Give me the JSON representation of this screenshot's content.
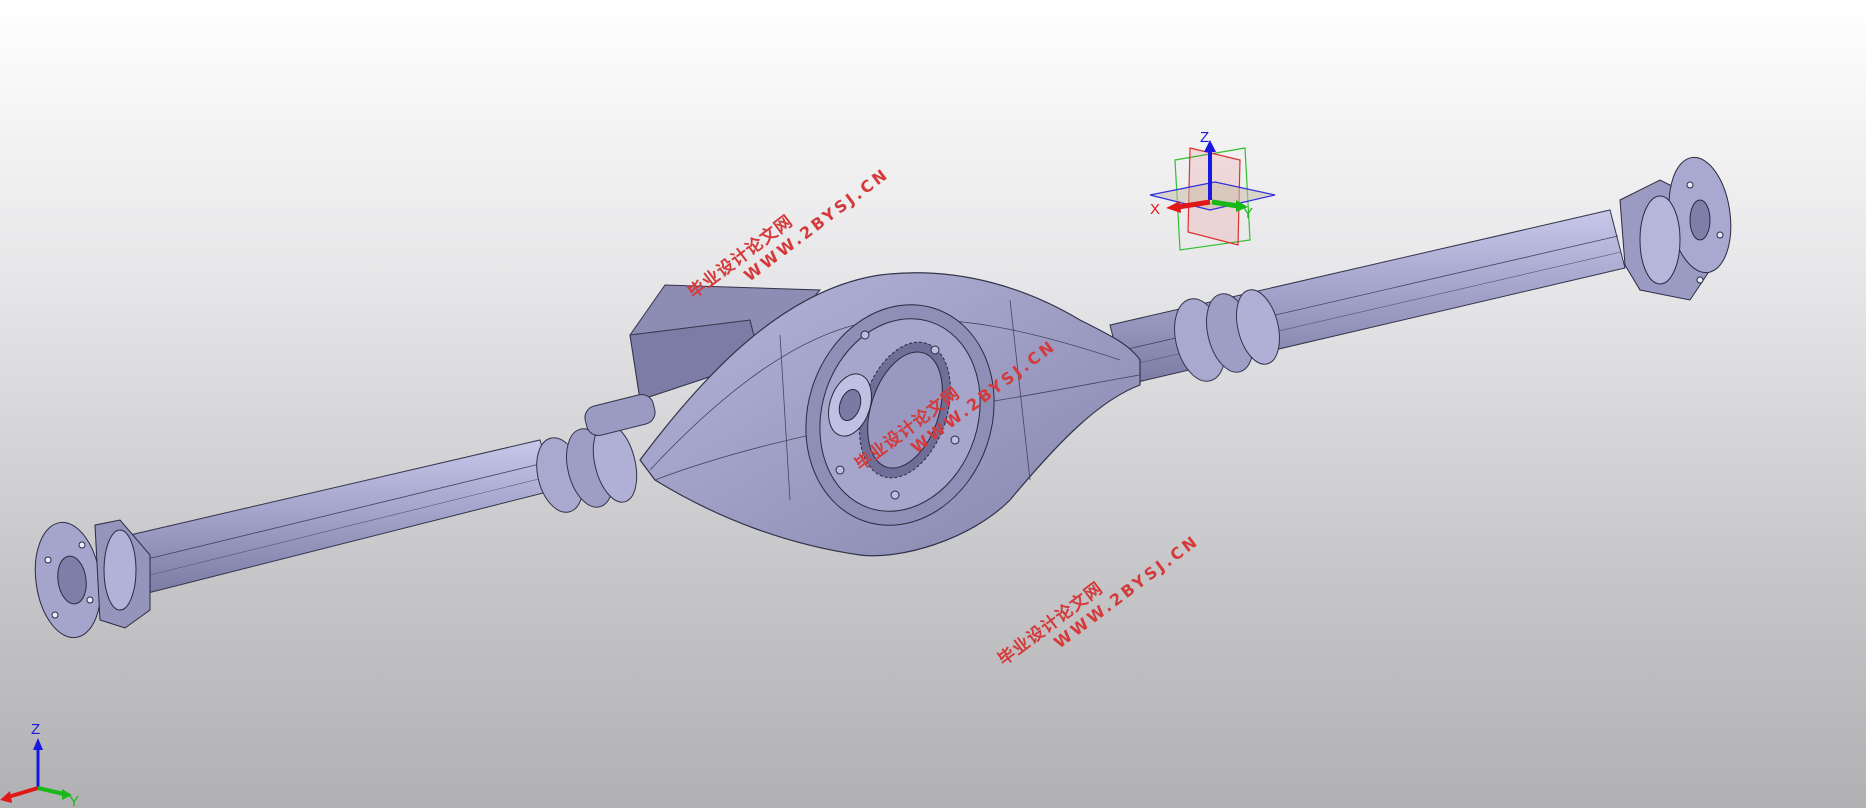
{
  "watermark": {
    "line1": "毕业设计论文网",
    "line2": "WWW.2BYSJ.CN"
  },
  "compass": {
    "z": "Z",
    "x": "X",
    "y": "Y"
  },
  "triad": {
    "z": "Z",
    "y": "Y"
  },
  "colors": {
    "part_fill": "#9c9cc4",
    "part_dark": "#7e7ea8",
    "part_light": "#bdbde0",
    "edge": "#33334a",
    "watermark": "#d43a3a",
    "axis_x": "#e01818",
    "axis_y": "#18b818",
    "axis_z": "#1818e0"
  }
}
